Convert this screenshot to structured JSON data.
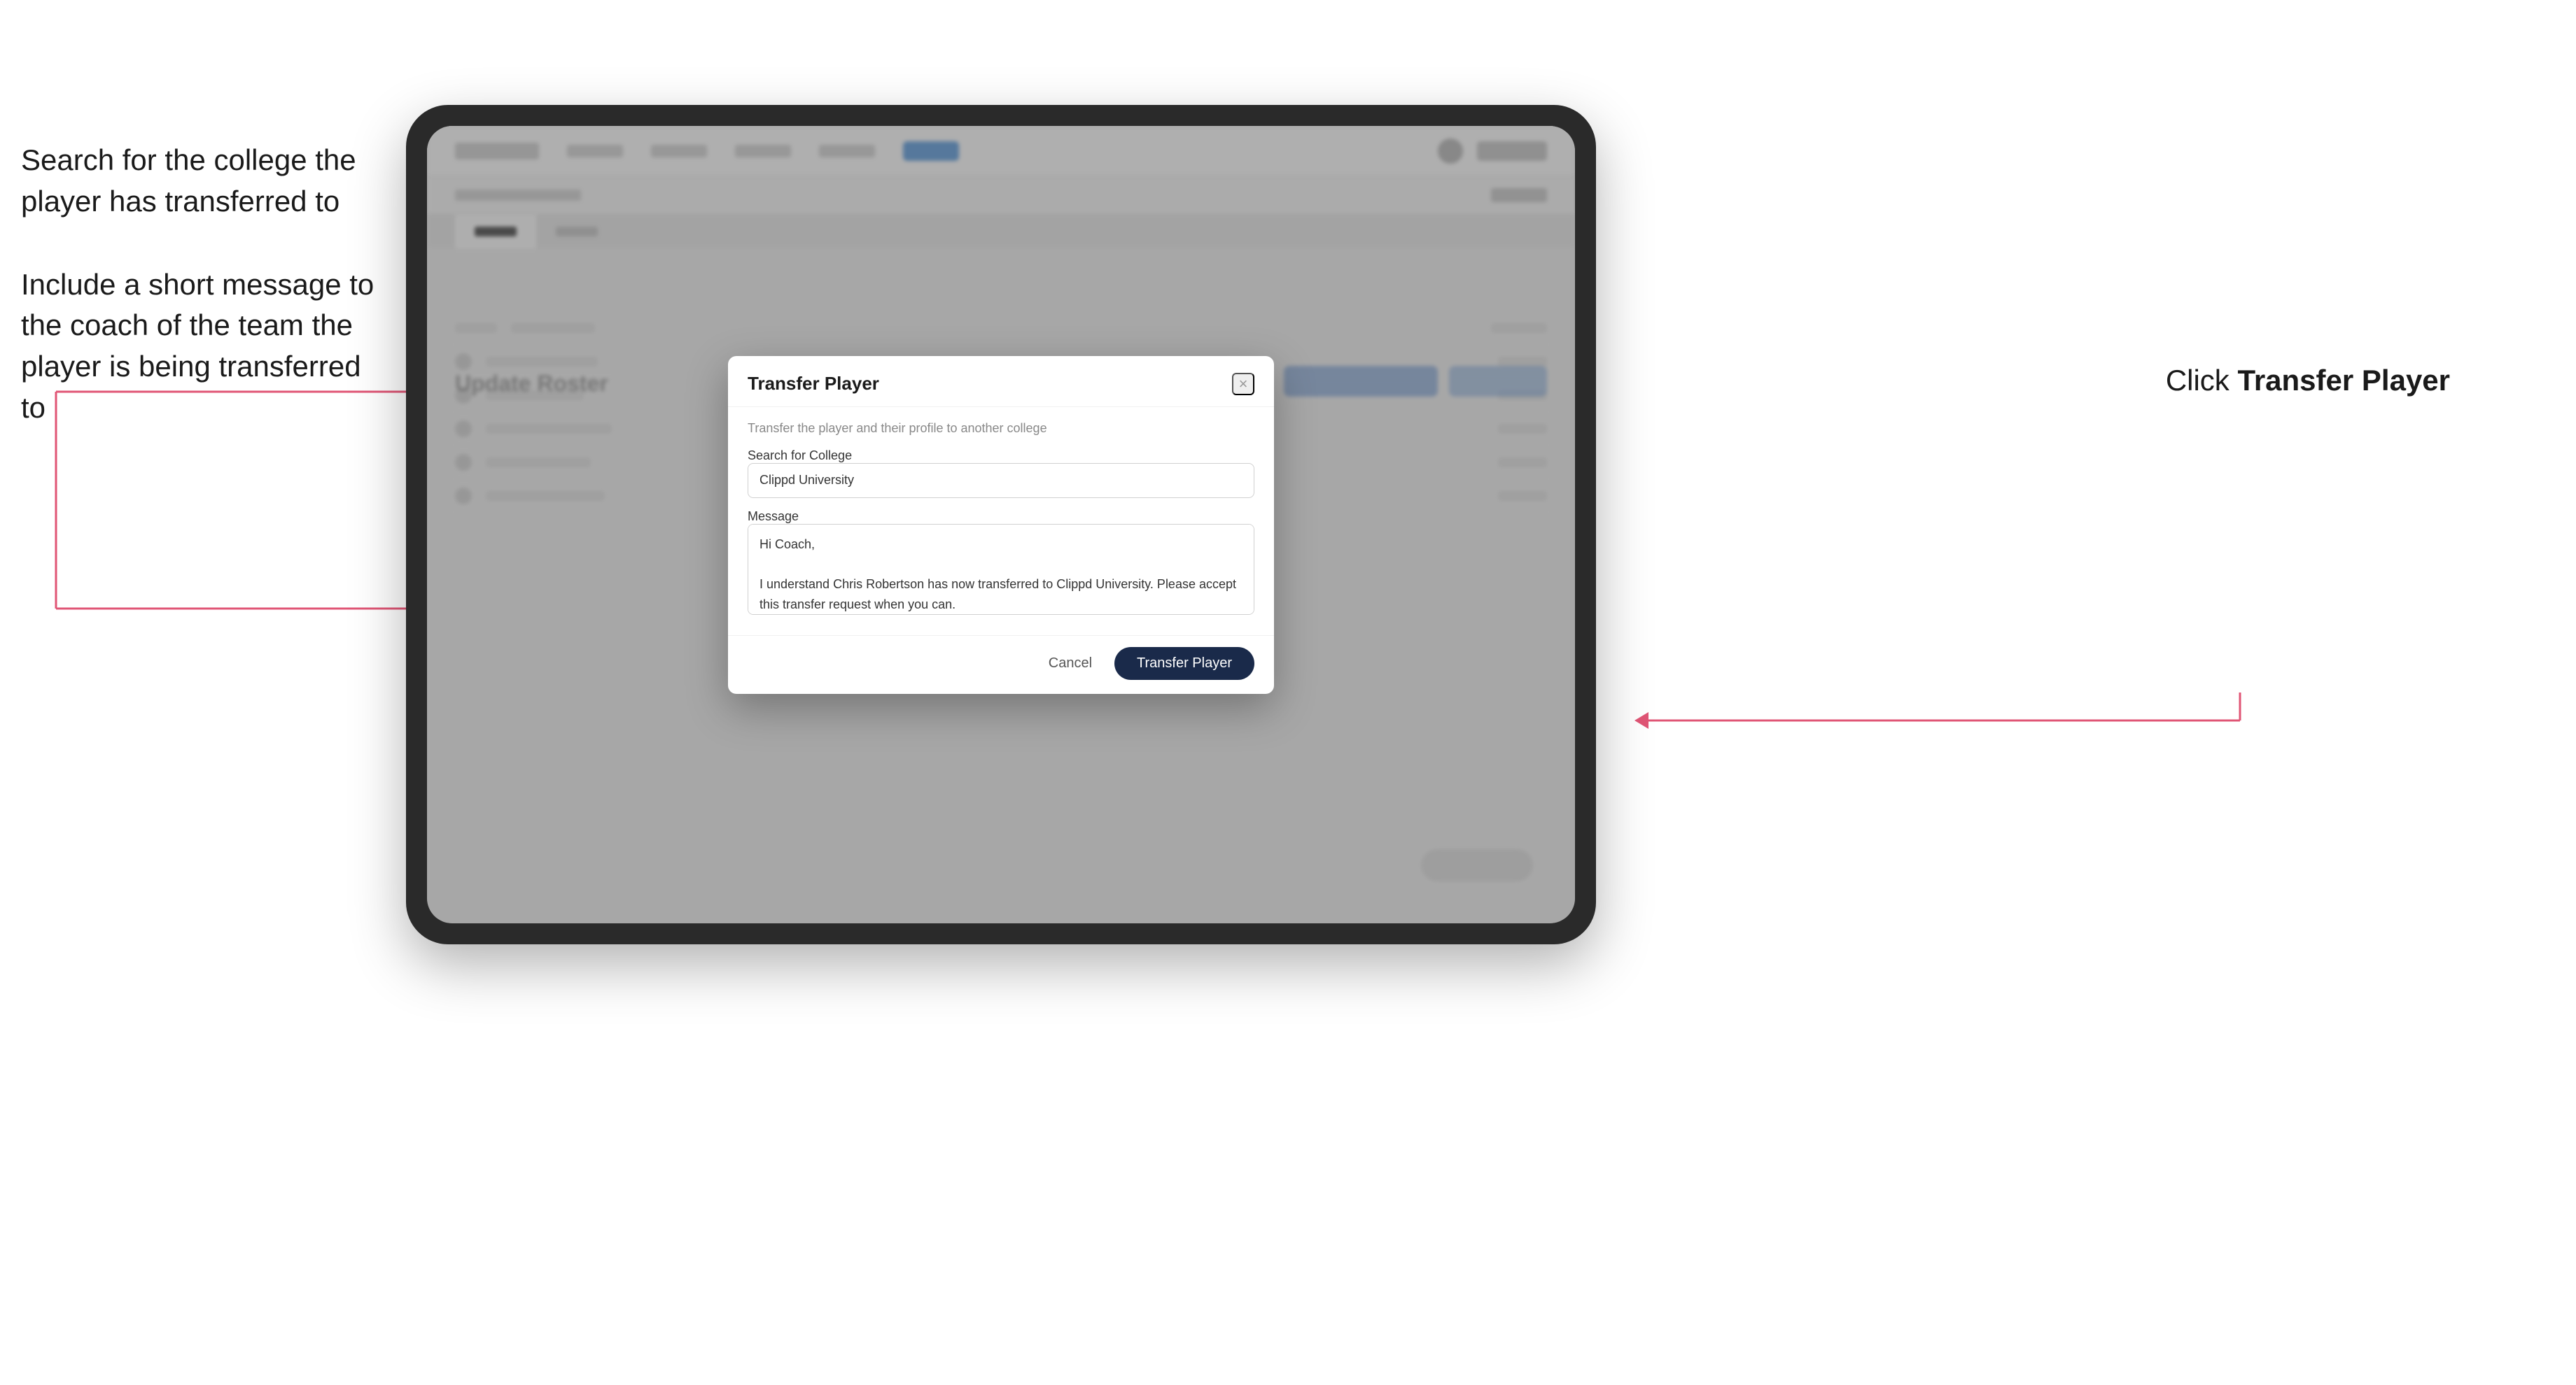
{
  "annotations": {
    "left_top": "Search for the college the player has transferred to",
    "left_bottom": "Include a short message to the coach of the team the player is being transferred to",
    "right": "Click ",
    "right_bold": "Transfer Player"
  },
  "tablet": {
    "topbar": {
      "logo_label": "Logo",
      "nav_items": [
        "Community",
        "Tools",
        "Analytics",
        "More Info",
        "Active"
      ],
      "avatar_label": "User Avatar",
      "btn_label": "Some Action"
    },
    "subbar": {
      "breadcrumb": "Enrolled (71)",
      "right_text": "Group 1"
    },
    "tabs": {
      "items": [
        "Tabs",
        "Active"
      ]
    },
    "content": {
      "update_roster": "Update Roster"
    }
  },
  "modal": {
    "title": "Transfer Player",
    "subtitle": "Transfer the player and their profile to another college",
    "search_label": "Search for College",
    "search_value": "Clippd University",
    "search_placeholder": "Search for College",
    "message_label": "Message",
    "message_value": "Hi Coach,\n\nI understand Chris Robertson has now transferred to Clippd University. Please accept this transfer request when you can.",
    "cancel_label": "Cancel",
    "transfer_label": "Transfer Player"
  }
}
